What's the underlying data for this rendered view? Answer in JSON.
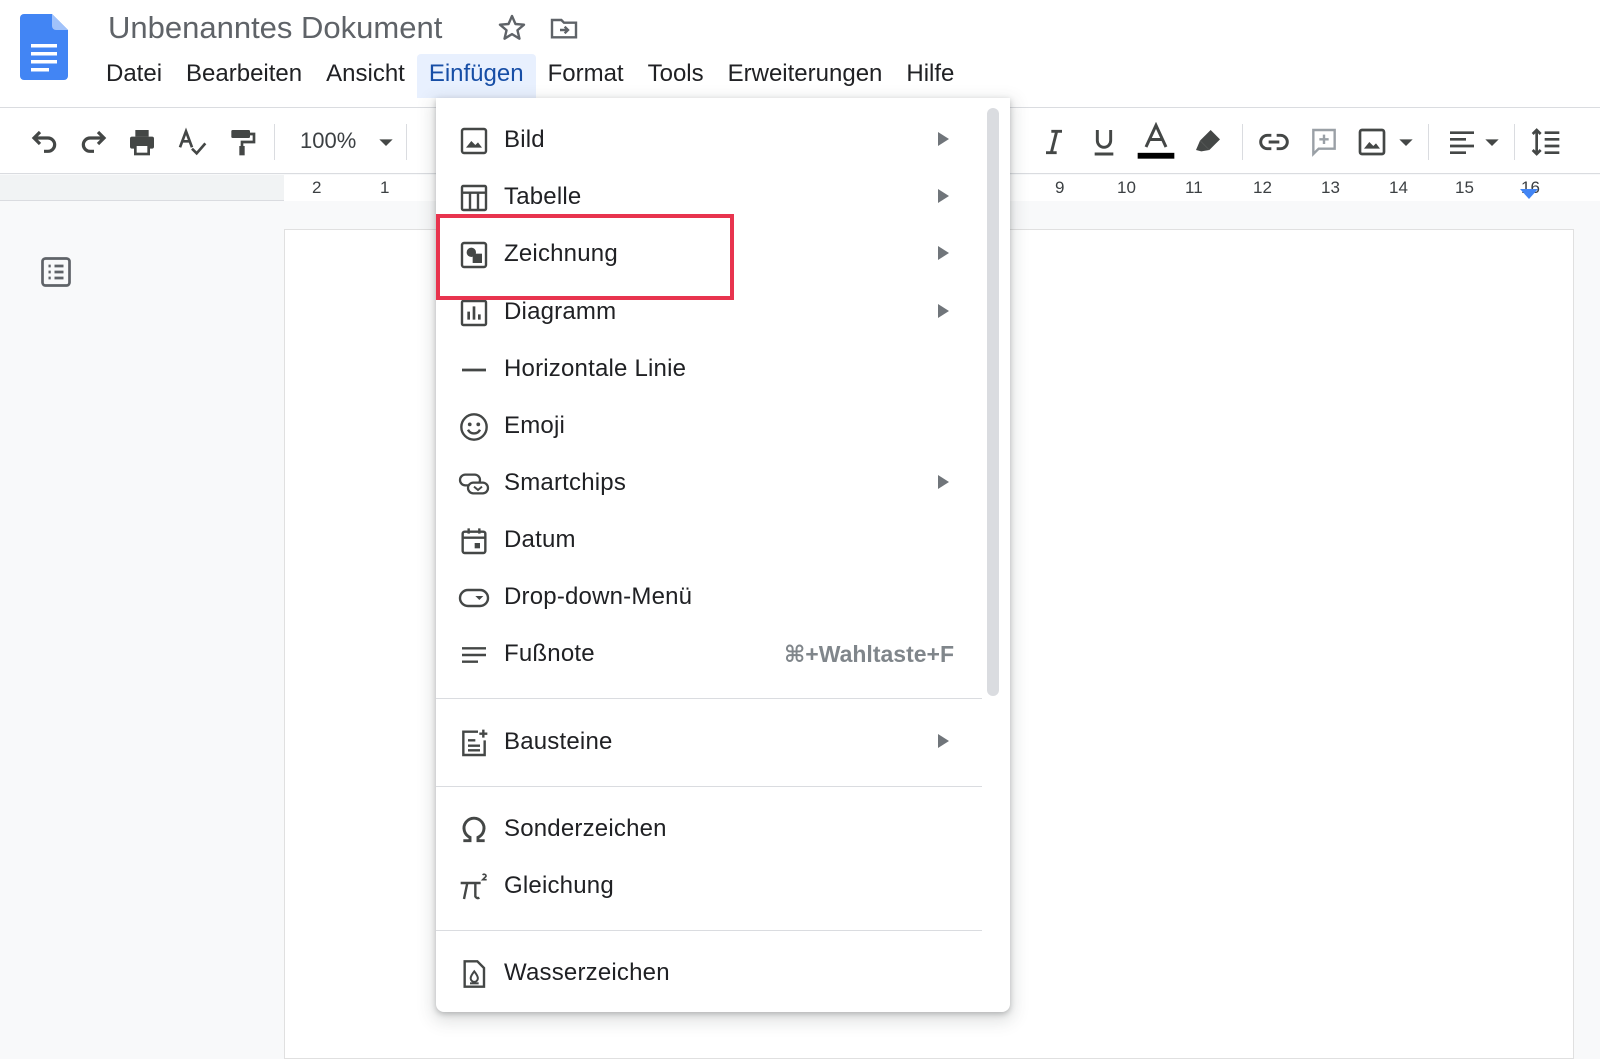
{
  "document": {
    "title": "Unbenanntes Dokument"
  },
  "menubar": [
    {
      "id": "datei",
      "label": "Datei"
    },
    {
      "id": "bearbeiten",
      "label": "Bearbeiten"
    },
    {
      "id": "ansicht",
      "label": "Ansicht"
    },
    {
      "id": "einfuegen",
      "label": "Einfügen",
      "active": true
    },
    {
      "id": "format",
      "label": "Format"
    },
    {
      "id": "tools",
      "label": "Tools"
    },
    {
      "id": "erweiterungen",
      "label": "Erweiterungen"
    },
    {
      "id": "hilfe",
      "label": "Hilfe"
    }
  ],
  "toolbar": {
    "zoom": "100%"
  },
  "ruler": {
    "labels": [
      "2",
      "1",
      "9",
      "10",
      "11",
      "12",
      "13",
      "14",
      "15",
      "16"
    ]
  },
  "insert_menu": {
    "items": [
      {
        "id": "bild",
        "label": "Bild",
        "icon": "image-icon",
        "submenu": true
      },
      {
        "id": "tabelle",
        "label": "Tabelle",
        "icon": "table-icon",
        "submenu": true
      },
      {
        "id": "zeichnung",
        "label": "Zeichnung",
        "icon": "drawing-icon",
        "submenu": true,
        "highlighted": true
      },
      {
        "id": "diagramm",
        "label": "Diagramm",
        "icon": "chart-icon",
        "submenu": true
      },
      {
        "id": "linie",
        "label": "Horizontale Linie",
        "icon": "horizontal-line-icon",
        "submenu": false
      },
      {
        "id": "emoji",
        "label": "Emoji",
        "icon": "emoji-icon",
        "submenu": false
      },
      {
        "id": "smartchips",
        "label": "Smartchips",
        "icon": "smartchips-icon",
        "submenu": true
      },
      {
        "id": "datum",
        "label": "Datum",
        "icon": "calendar-icon",
        "submenu": false
      },
      {
        "id": "dropdown",
        "label": "Drop-down-Menü",
        "icon": "dropdown-chip-icon",
        "submenu": false
      },
      {
        "id": "fussnote",
        "label": "Fußnote",
        "icon": "footnote-icon",
        "submenu": false,
        "shortcut": "⌘+Wahltaste+F"
      },
      {
        "id": "bausteine",
        "label": "Bausteine",
        "icon": "building-blocks-icon",
        "submenu": true
      },
      {
        "id": "sonderzeichen",
        "label": "Sonderzeichen",
        "icon": "omega-icon",
        "submenu": false
      },
      {
        "id": "gleichung",
        "label": "Gleichung",
        "icon": "pi-icon",
        "submenu": false
      },
      {
        "id": "wasserzeichen",
        "label": "Wasserzeichen",
        "icon": "watermark-icon",
        "submenu": false
      }
    ]
  },
  "colors": {
    "accent": "#1a73e8",
    "highlight_box": "#e8344e",
    "menu_active_bg": "#e8f0fe"
  }
}
